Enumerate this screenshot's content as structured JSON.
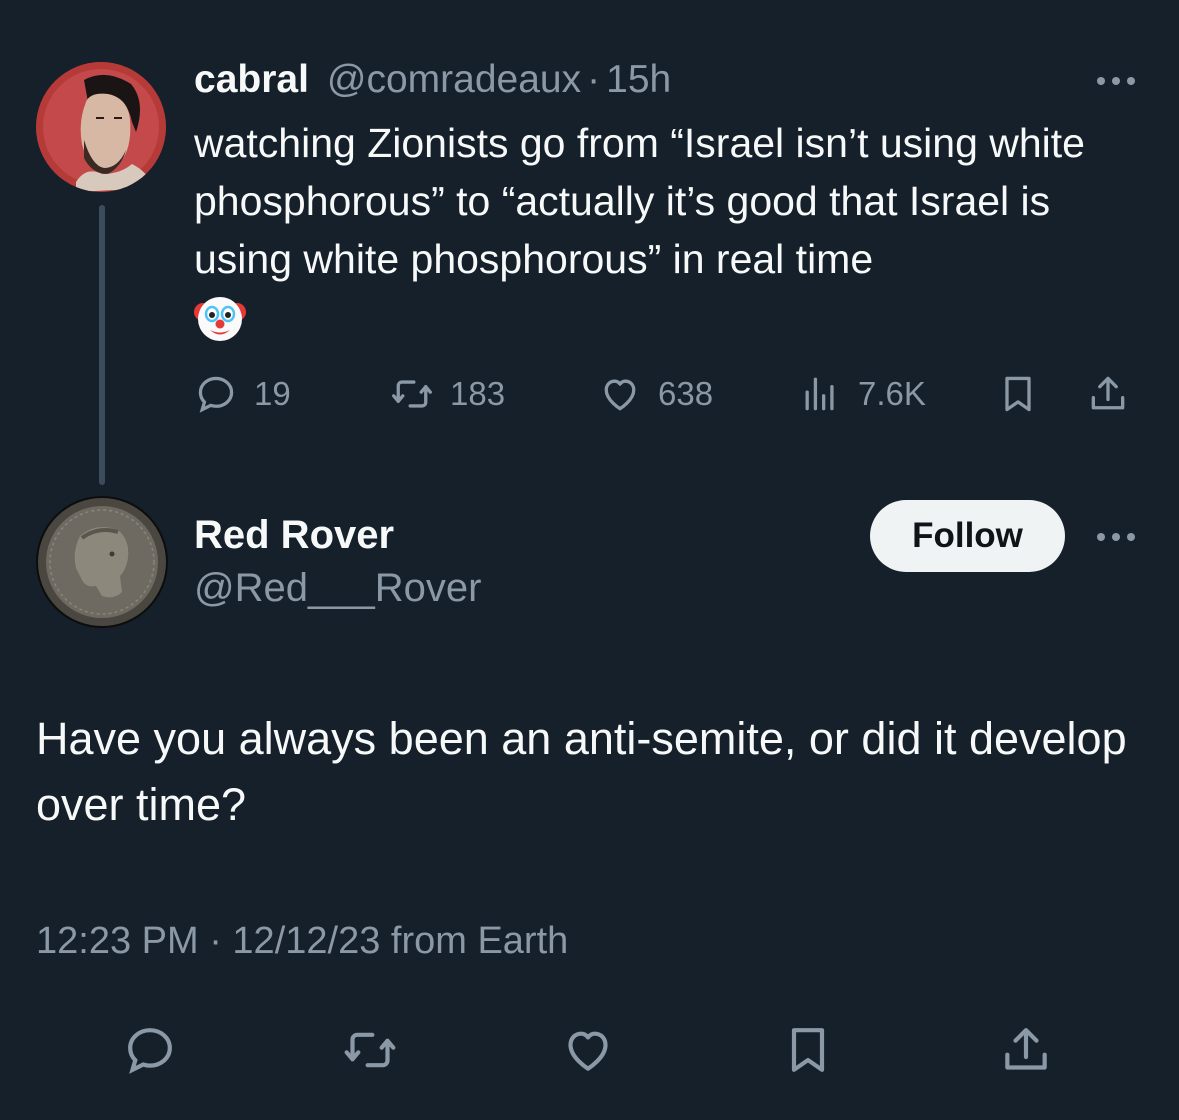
{
  "parent_tweet": {
    "display_name": "cabral",
    "handle": "@comradeaux",
    "separator": "·",
    "time": "15h",
    "text": "watching Zionists go from “Israel isn’t using white phosphorous” to “actually it’s good that Israel is using white phosphorous” in real time",
    "emoji": "clown-face",
    "metrics": {
      "replies": "19",
      "reposts": "183",
      "likes": "638",
      "views": "7.6K"
    }
  },
  "reply_tweet": {
    "display_name": "Red Rover",
    "handle": "@Red___Rover",
    "follow_label": "Follow",
    "text": "Have you always been an anti-semite, or did it develop over time?",
    "timestamp": "12:23 PM · 12/12/23 from Earth"
  },
  "colors": {
    "background": "#15202b",
    "text_primary": "#f7f9f9",
    "text_secondary": "#8b98a5",
    "thread_line": "#3d4c5c",
    "follow_bg": "#eff3f4"
  }
}
